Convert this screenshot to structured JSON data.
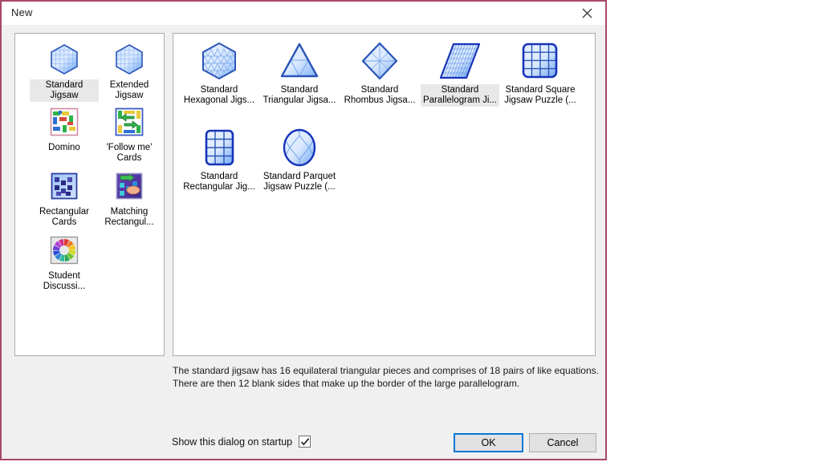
{
  "dialog": {
    "title": "New",
    "close_icon": "close-icon"
  },
  "left_panel": {
    "items": [
      {
        "label": "Standard\nJigsaw",
        "icon": "hexagon-jigsaw-icon",
        "selected": true
      },
      {
        "label": "Extended\nJigsaw",
        "icon": "hexagon-jigsaw-icon",
        "selected": false
      },
      {
        "label": "Domino",
        "icon": "domino-icon",
        "selected": false
      },
      {
        "label": "'Follow me'\nCards",
        "icon": "follow-me-cards-icon",
        "selected": false
      },
      {
        "label": "Rectangular\nCards",
        "icon": "rectangular-cards-icon",
        "selected": false
      },
      {
        "label": "Matching\nRectangul...",
        "icon": "matching-rectangles-icon",
        "selected": false
      },
      {
        "label": "Student\nDiscussi...",
        "icon": "student-discussion-icon",
        "selected": false
      }
    ]
  },
  "right_panel": {
    "items": [
      {
        "label": "Standard\nHexagonal Jigs...",
        "icon": "hexagon-puzzle-icon",
        "selected": false
      },
      {
        "label": "Standard\nTriangular Jigsa...",
        "icon": "triangle-puzzle-icon",
        "selected": false
      },
      {
        "label": "Standard\nRhombus Jigsa...",
        "icon": "rhombus-puzzle-icon",
        "selected": false
      },
      {
        "label": "Standard\nParallelogram Ji...",
        "icon": "parallelogram-puzzle-icon",
        "selected": true
      },
      {
        "label": "Standard Square\nJigsaw Puzzle (...",
        "icon": "square-puzzle-icon",
        "selected": false
      },
      {
        "label": "Standard\nRectangular Jig...",
        "icon": "rectangle-puzzle-icon",
        "selected": false
      },
      {
        "label": "Standard Parquet\nJigsaw Puzzle (...",
        "icon": "parquet-puzzle-icon",
        "selected": false
      }
    ]
  },
  "description": {
    "line1": "The standard jigsaw has 16 equilateral triangular pieces and comprises of 18 pairs of like equations.",
    "line2": "There are then 12 blank sides that make up the border of the large parallelogram."
  },
  "footer": {
    "startup_label": "Show this dialog on startup",
    "startup_checked": true,
    "ok_label": "OK",
    "cancel_label": "Cancel"
  },
  "colors": {
    "dialog_border": "#a8476b",
    "focus_blue": "#0078d7",
    "panel_bg": "#ffffff",
    "dialog_bg": "#f0f0f0",
    "selection_bg": "#e8e8e8"
  }
}
